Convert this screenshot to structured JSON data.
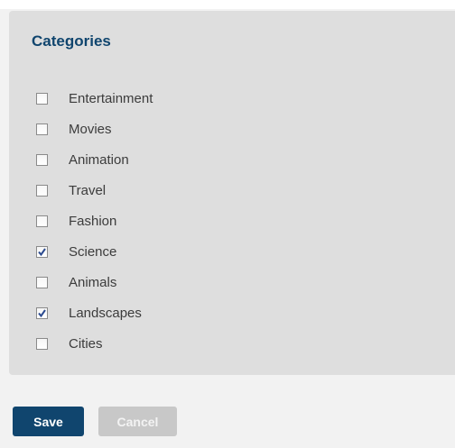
{
  "panel": {
    "title": "Categories",
    "categories": [
      {
        "label": "Entertainment",
        "checked": false
      },
      {
        "label": "Movies",
        "checked": false
      },
      {
        "label": "Animation",
        "checked": false
      },
      {
        "label": "Travel",
        "checked": false
      },
      {
        "label": "Fashion",
        "checked": false
      },
      {
        "label": "Science",
        "checked": true
      },
      {
        "label": "Animals",
        "checked": false
      },
      {
        "label": "Landscapes",
        "checked": true
      },
      {
        "label": "Cities",
        "checked": false
      }
    ]
  },
  "actions": {
    "save_label": "Save",
    "cancel_label": "Cancel"
  },
  "colors": {
    "accent": "#10456e",
    "panel_background": "#dedede",
    "page_background": "#f2f2f2",
    "cancel_background": "#c8c8c8",
    "check_mark": "#2b4a8f"
  }
}
